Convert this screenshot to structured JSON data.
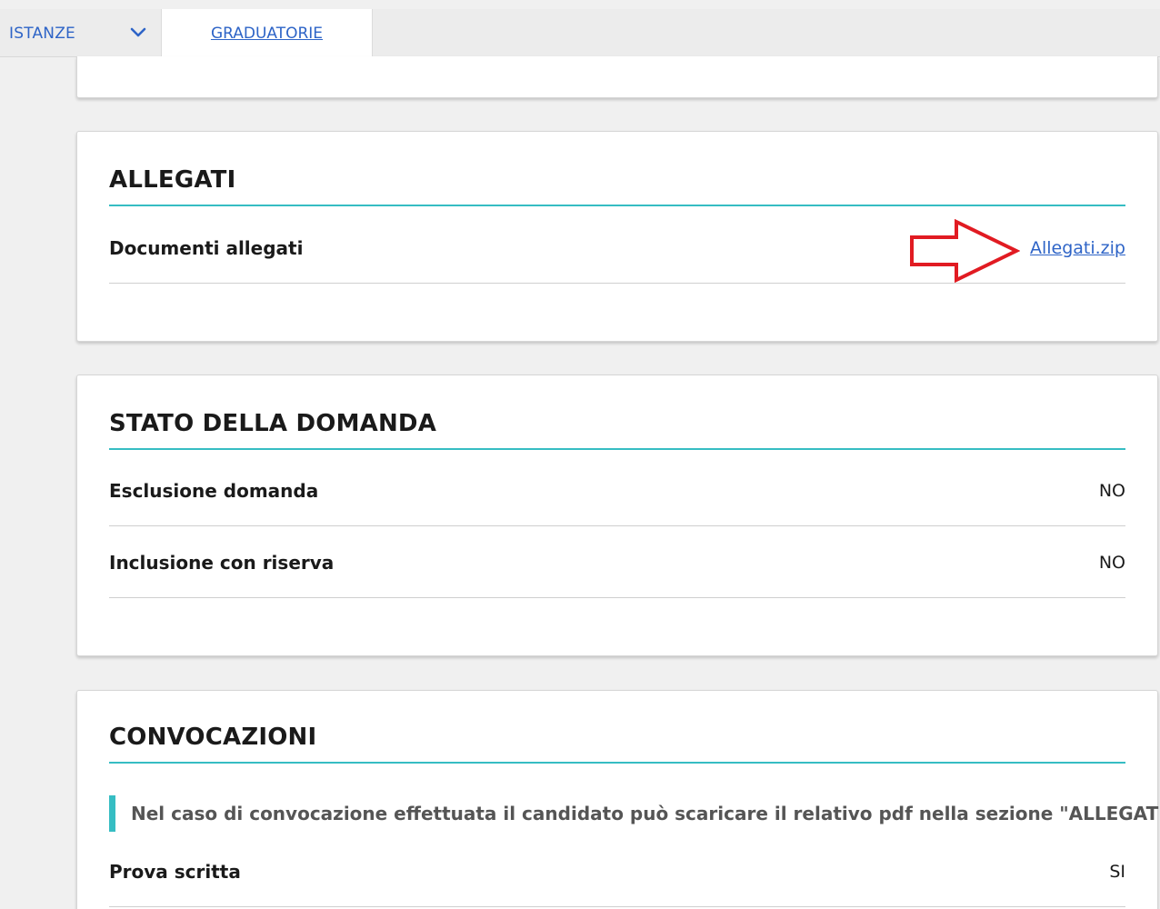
{
  "nav": {
    "istanze_label": "ISTANZE",
    "graduatorie_label": "GRADUATORIE"
  },
  "allegati": {
    "title": "ALLEGATI",
    "rows": [
      {
        "label": "Documenti allegati",
        "value": "Allegati.zip"
      }
    ]
  },
  "stato": {
    "title": "STATO DELLA DOMANDA",
    "rows": [
      {
        "label": "Esclusione domanda",
        "value": "NO"
      },
      {
        "label": "Inclusione con riserva",
        "value": "NO"
      }
    ]
  },
  "convocazioni": {
    "title": "CONVOCAZIONI",
    "note": "Nel caso di convocazione effettuata il candidato può scaricare il relativo pdf nella sezione \"ALLEGATI\"",
    "rows": [
      {
        "label": "Prova scritta",
        "value": "SI"
      }
    ]
  },
  "colors": {
    "accent": "#36bdc3",
    "link": "#2e64c7",
    "annotation_arrow": "#e11b22"
  },
  "icons": {
    "nav_dropdown": "chevron-down-icon",
    "annotation": "red-arrow-icon"
  }
}
